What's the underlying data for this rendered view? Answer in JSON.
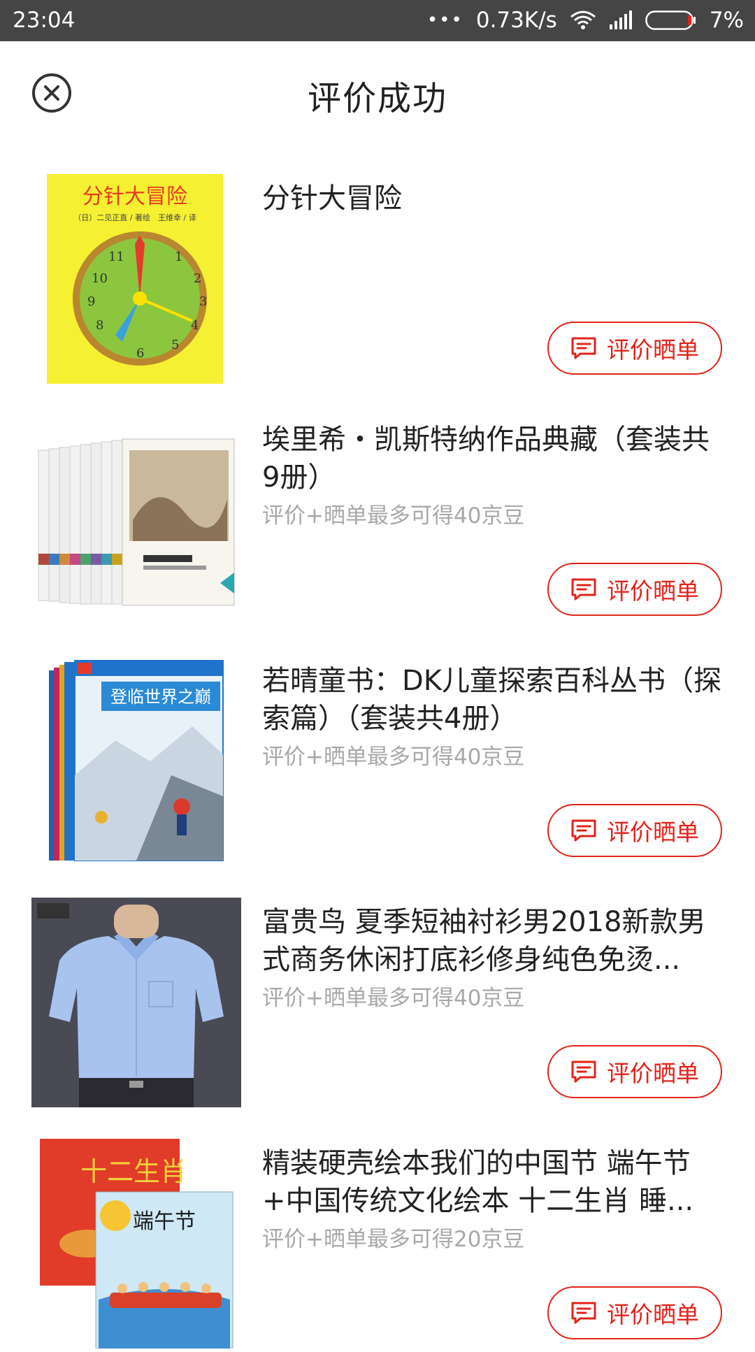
{
  "status_bar": {
    "time": "23:04",
    "dots": "•••",
    "speed": "0.73K/s",
    "battery": "7%"
  },
  "header": {
    "title": "评价成功",
    "close_icon": "close-circle-icon"
  },
  "colors": {
    "accent": "#e2231a",
    "status_bar_bg": "#454545",
    "muted_text": "#a8a8a8"
  },
  "items": [
    {
      "title": "分针大冒险",
      "reward": "",
      "button_label": "评价晒单",
      "button_icon": "comment-icon"
    },
    {
      "title": "埃里希・凯斯特纳作品典藏（套装共9册）",
      "reward": "评价+晒单最多可得40京豆",
      "button_label": "评价晒单",
      "button_icon": "comment-icon"
    },
    {
      "title": "若晴童书：DK儿童探索百科丛书（探索篇）（套装共4册）",
      "reward": "评价+晒单最多可得40京豆",
      "button_label": "评价晒单",
      "button_icon": "comment-icon"
    },
    {
      "title": "富贵鸟 夏季短袖衬衫男2018新款男式商务休闲打底衫修身纯色免烫...",
      "reward": "评价+晒单最多可得40京豆",
      "button_label": "评价晒单",
      "button_icon": "comment-icon"
    },
    {
      "title": "精装硬壳绘本我们的中国节 端午节+中国传统文化绘本 十二生肖 睡...",
      "reward": "评价+晒单最多可得20京豆",
      "button_label": "评价晒单",
      "button_icon": "comment-icon"
    }
  ]
}
